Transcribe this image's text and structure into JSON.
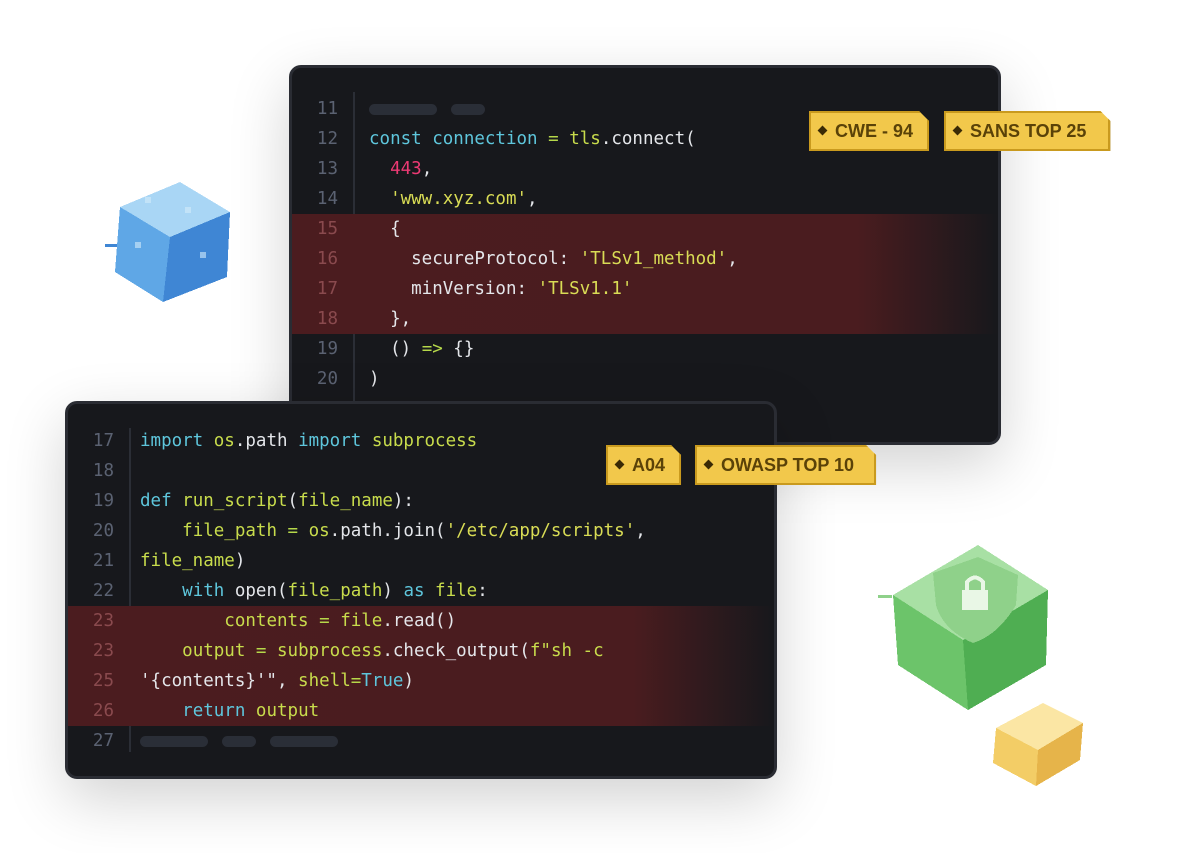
{
  "editor_top": {
    "lines": [
      {
        "n": "11",
        "placeholder": true
      },
      {
        "n": "12",
        "tokens": [
          [
            "kw",
            "const "
          ],
          [
            "kw",
            "connection "
          ],
          [
            "op",
            "= "
          ],
          [
            "fn",
            "tls"
          ],
          [
            "",
            "."
          ],
          [
            "",
            "connect("
          ]
        ]
      },
      {
        "n": "13",
        "tokens": [
          [
            "",
            "  "
          ],
          [
            "num",
            "443"
          ],
          [
            "",
            ","
          ]
        ]
      },
      {
        "n": "14",
        "tokens": [
          [
            "",
            "  "
          ],
          [
            "str",
            "'www.xyz.com'"
          ],
          [
            "",
            ","
          ]
        ]
      },
      {
        "n": "15",
        "hl": true,
        "tokens": [
          [
            "",
            "  {"
          ]
        ]
      },
      {
        "n": "16",
        "hl": true,
        "tokens": [
          [
            "",
            "    secureProtocol: "
          ],
          [
            "str",
            "'TLSv1_method'"
          ],
          [
            "",
            ","
          ]
        ]
      },
      {
        "n": "17",
        "hl": true,
        "tokens": [
          [
            "",
            "    minVersion: "
          ],
          [
            "str",
            "'TLSv1.1'"
          ]
        ]
      },
      {
        "n": "18",
        "hl": true,
        "tokens": [
          [
            "",
            "  },"
          ]
        ]
      },
      {
        "n": "19",
        "tokens": [
          [
            "",
            "  () "
          ],
          [
            "op",
            "=>"
          ],
          [
            "",
            " {}"
          ]
        ]
      },
      {
        "n": "20",
        "tokens": [
          [
            "",
            ")"
          ]
        ]
      }
    ],
    "badges": [
      "CWE - 94",
      "SANS TOP 25"
    ]
  },
  "editor_bottom": {
    "lines": [
      {
        "n": "17",
        "tokens": [
          [
            "kw",
            "import "
          ],
          [
            "fn",
            "os"
          ],
          [
            "",
            ".path "
          ],
          [
            "kw",
            "import "
          ],
          [
            "fn",
            "subprocess"
          ]
        ]
      },
      {
        "n": "18",
        "tokens": []
      },
      {
        "n": "19",
        "tokens": [
          [
            "kw",
            "def "
          ],
          [
            "fn",
            "run_script"
          ],
          [
            "",
            "("
          ],
          [
            "fn",
            "file_name"
          ],
          [
            "",
            "):"
          ]
        ]
      },
      {
        "n": "20",
        "tokens": [
          [
            "",
            "    "
          ],
          [
            "fn",
            "file_path "
          ],
          [
            "op",
            "= "
          ],
          [
            "fn",
            "os"
          ],
          [
            "",
            ".path.join("
          ],
          [
            "str",
            "'/etc/app/scripts'"
          ],
          [
            "",
            ","
          ]
        ]
      },
      {
        "n": "21",
        "tokens": [
          [
            "fn",
            "file_name"
          ],
          [
            "",
            ")"
          ]
        ]
      },
      {
        "n": "22",
        "tokens": [
          [
            "",
            "    "
          ],
          [
            "kw",
            "with "
          ],
          [
            "",
            "open("
          ],
          [
            "fn",
            "file_path"
          ],
          [
            "",
            ") "
          ],
          [
            "kw",
            "as "
          ],
          [
            "fn",
            "file"
          ],
          [
            "",
            ":"
          ]
        ]
      },
      {
        "n": "23",
        "hl": true,
        "tokens": [
          [
            "",
            "        "
          ],
          [
            "fn",
            "contents "
          ],
          [
            "op",
            "= "
          ],
          [
            "fn",
            "file"
          ],
          [
            "",
            ".read()"
          ]
        ]
      },
      {
        "n": "23",
        "hl": true,
        "tokens": [
          [
            "",
            "    "
          ],
          [
            "fn",
            "output "
          ],
          [
            "op",
            "= "
          ],
          [
            "fn",
            "subprocess"
          ],
          [
            "",
            ".check_output("
          ],
          [
            "fn",
            "f\"sh -c"
          ]
        ]
      },
      {
        "n": "25",
        "hl": true,
        "tokens": [
          [
            "",
            "'{contents}'\", "
          ],
          [
            "fn",
            "shell"
          ],
          [
            "op",
            "="
          ],
          [
            "kw",
            "True"
          ],
          [
            "",
            ")"
          ]
        ]
      },
      {
        "n": "26",
        "hl": true,
        "tokens": [
          [
            "",
            "    "
          ],
          [
            "kw",
            "return "
          ],
          [
            "fn",
            "output"
          ]
        ]
      },
      {
        "n": "27",
        "placeholder": true
      }
    ],
    "badges": [
      "A04",
      "OWASP TOP 10"
    ]
  },
  "colors": {
    "background": "#17181c",
    "highlight": "#4a1c1f",
    "keyword": "#5ec6dc",
    "identifier": "#c8dc4c",
    "string": "#d9dc55",
    "number": "#ec3a74",
    "badge": "#f2c84b"
  },
  "decorations": [
    "blue-cube-icon",
    "green-shield-lock-cube-icon",
    "yellow-cube-icon"
  ]
}
